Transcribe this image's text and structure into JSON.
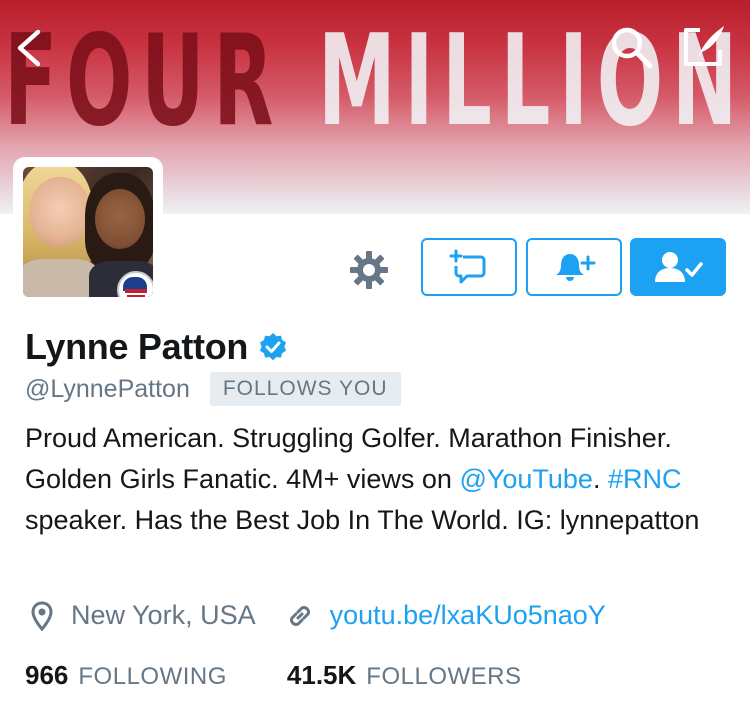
{
  "banner": {
    "word1": "FOUR",
    "word2": "MILLION"
  },
  "icons": {
    "back": "back-chevron-icon",
    "search": "search-icon",
    "compose": "compose-icon",
    "settings": "gear-icon",
    "direct_message": "direct-message-icon",
    "notifications": "bell-plus-icon",
    "following": "user-check-icon",
    "verified": "verified-badge-icon",
    "location": "location-pin-icon",
    "link": "link-icon"
  },
  "colors": {
    "accent": "#1da1f2",
    "muted": "#657786",
    "text": "#14171a",
    "badge_bg": "#e6ecf0"
  },
  "profile": {
    "name": "Lynne Patton",
    "handle": "@LynnePatton",
    "follows_you": "FOLLOWS YOU",
    "bio": {
      "part1": "Proud American. Struggling Golfer. Marathon Finisher. Golden Girls Fanatic. 4M+ views on ",
      "mention": "@YouTube",
      "part2": ". ",
      "hashtag": "#RNC",
      "part3": " speaker. Has the Best Job In The World. IG: lynnepatton"
    },
    "location": "New York, USA",
    "url": "youtu.be/lxaKUo5naoY"
  },
  "stats": {
    "following_count": "966",
    "following_label": "FOLLOWING",
    "followers_count": "41.5K",
    "followers_label": "FOLLOWERS"
  }
}
